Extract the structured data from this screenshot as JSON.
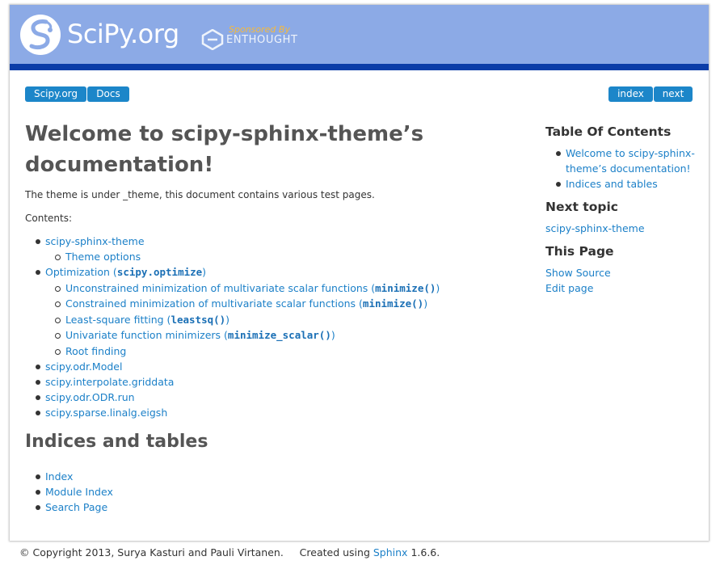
{
  "header": {
    "logo_text": "SciPy.org",
    "sponsor_line": "Sponsored By",
    "sponsor_name": "ENTHOUGHT"
  },
  "nav": {
    "left": [
      "Scipy.org",
      "Docs"
    ],
    "right": [
      "index",
      "next"
    ]
  },
  "main": {
    "title_line1": "Welcome to scipy-sphinx-theme’s",
    "title_line2": "documentation!",
    "intro": "The theme is under _theme, this document contains various test pages.",
    "contents_label": "Contents:",
    "toc": {
      "item1": "scipy-sphinx-theme",
      "item1_sub1": "Theme options",
      "item2_pre": "Optimization (",
      "item2_code": "scipy.optimize",
      "item2_post": ")",
      "sub1_pre": "Unconstrained minimization of multivariate scalar functions (",
      "sub1_code": "minimize()",
      "sub1_post": ")",
      "sub2_pre": "Constrained minimization of multivariate scalar functions (",
      "sub2_code": "minimize()",
      "sub2_post": ")",
      "sub3_pre": "Least-square fitting (",
      "sub3_code": "leastsq()",
      "sub3_post": ")",
      "sub4_pre": "Univariate function minimizers (",
      "sub4_code": "minimize_scalar()",
      "sub4_post": ")",
      "sub5": "Root finding",
      "item3": "scipy.odr.Model",
      "item4": "scipy.interpolate.griddata",
      "item5": "scipy.odr.ODR.run",
      "item6": "scipy.sparse.linalg.eigsh"
    },
    "indices_title": "Indices and tables",
    "indices": [
      "Index",
      "Module Index",
      "Search Page"
    ]
  },
  "sidebar": {
    "toc_title": "Table Of Contents",
    "toc_item1_line1": "Welcome to scipy-sphinx-",
    "toc_item1_line2": "theme’s documentation!",
    "toc_item2": "Indices and tables",
    "next_title": "Next topic",
    "next_link": "scipy-sphinx-theme",
    "this_page_title": "This Page",
    "show_source": "Show Source",
    "edit_page": "Edit page"
  },
  "footer": {
    "copyright": "© Copyright 2013, Surya Kasturi and Pauli Virtanen.",
    "created_using": "Created using",
    "sphinx": "Sphinx",
    "version": "1.6.6."
  },
  "colors": {
    "header_bg": "#8caae6",
    "header_bar": "#0b3da8",
    "link": "#1c80c8",
    "pill": "#1c86c9"
  }
}
